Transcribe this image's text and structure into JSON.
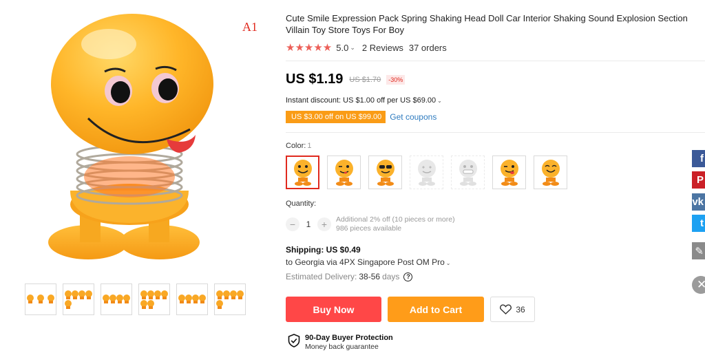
{
  "product": {
    "title": "Cute Smile Expression Pack Spring Shaking Head Doll Car Interior Shaking Sound Explosion Section Villain Toy Store Toys For Boy",
    "model_code": "A1",
    "rating": {
      "stars": 5,
      "value": "5.0",
      "reviews": "2 Reviews",
      "orders": "37 orders"
    }
  },
  "price": {
    "current": "US $1.19",
    "original": "US $1.70",
    "discount": "-30%",
    "instant_discount": "Instant discount: US $1.00 off per US $69.00",
    "coupon": "US $3.00 off on US $99.00",
    "get_coupons": "Get coupons"
  },
  "color": {
    "label": "Color:",
    "selected_value": "1",
    "options": [
      {
        "face": "smile",
        "available": true
      },
      {
        "face": "wink",
        "available": true
      },
      {
        "face": "sunglasses",
        "available": true
      },
      {
        "face": "heart-eyes",
        "available": false
      },
      {
        "face": "grin",
        "available": false
      },
      {
        "face": "wink-tongue",
        "available": true
      },
      {
        "face": "happy",
        "available": true
      }
    ]
  },
  "quantity": {
    "label": "Quantity:",
    "value": "1",
    "additional": "Additional 2% off (10 pieces or more)",
    "available": "986 pieces available"
  },
  "shipping": {
    "cost": "Shipping: US $0.49",
    "destination": "to Georgia via 4PX Singapore Post OM Pro",
    "delivery_label": "Estimated Delivery:",
    "delivery_days": "38-56",
    "delivery_unit": "days"
  },
  "actions": {
    "buy_now": "Buy Now",
    "add_to_cart": "Add to Cart",
    "wishlist_count": "36"
  },
  "protection": {
    "title": "90-Day Buyer Protection",
    "subtitle": "Money back guarantee"
  },
  "social": {
    "facebook": "f",
    "pinterest": "P",
    "vk": "vk",
    "twitter": "t"
  },
  "colors": {
    "accent_red": "#ff4747",
    "accent_orange": "#ff9c19",
    "link_blue": "#2e7bbf",
    "star": "#ec5f58"
  },
  "gallery": {
    "thumbnail_counts": [
      3,
      5,
      4,
      6,
      4,
      5
    ]
  }
}
